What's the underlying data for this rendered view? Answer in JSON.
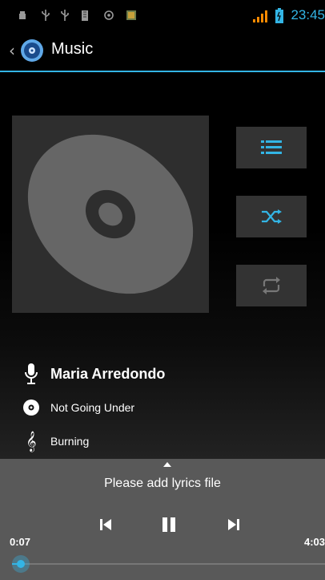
{
  "status_bar": {
    "time": "23:45",
    "icons": [
      "android-debug-icon",
      "usb-icon",
      "usb-icon",
      "sd-card-icon",
      "settings-icon",
      "photo-icon"
    ],
    "accent_color": "#33b5e5"
  },
  "action_bar": {
    "title": "Music",
    "app_icon": "music-disc-icon"
  },
  "side_buttons": [
    "now-playing-list-icon",
    "shuffle-icon",
    "repeat-icon"
  ],
  "track": {
    "artist": "Maria Arredondo",
    "album": "Not Going Under",
    "song": "Burning"
  },
  "lyrics": {
    "message": "Please add lyrics file"
  },
  "playback": {
    "elapsed": "0:07",
    "total": "4:03",
    "progress": 0.029,
    "state": "playing"
  },
  "colors": {
    "accent": "#33b5e5",
    "panel": "#595959",
    "button_bg": "#333333"
  }
}
